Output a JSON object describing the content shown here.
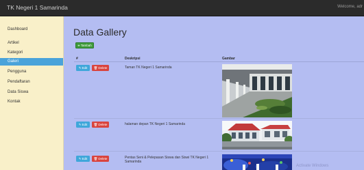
{
  "topbar": {
    "brand": "TK Negeri 1 Samarinda",
    "welcome": "Welcome, adr"
  },
  "sidebar": {
    "items": [
      {
        "label": "Dashboard",
        "active": false
      },
      {
        "label": "Artikel",
        "active": false
      },
      {
        "label": "Kategori",
        "active": false
      },
      {
        "label": "Galeri",
        "active": true
      },
      {
        "label": "Pengguna",
        "active": false
      },
      {
        "label": "Pendaftaran",
        "active": false
      },
      {
        "label": "Data Siswa",
        "active": false
      },
      {
        "label": "Kontak",
        "active": false
      }
    ]
  },
  "page": {
    "title": "Data Gallery",
    "add_label": "Tambah"
  },
  "table": {
    "headers": [
      "#",
      "Deskripsi",
      "Gambar"
    ],
    "edit_label": "Edit",
    "delete_label": "Delete",
    "rows": [
      {
        "desc": "Taman TK Negeri 1 Samarinda",
        "image": "school-garden-corridor-photo"
      },
      {
        "desc": "halaman depan TK Negeri 1 Samarinda",
        "image": "school-front-building-photo"
      },
      {
        "desc": "Pentas Seni & Pelepasan Siswa dan Siswi TK Negeri 1 Samarinda",
        "image": "stage-performance-photo"
      }
    ]
  },
  "watermark": "Activate Windows",
  "colors": {
    "topbar": "#2b2b2b",
    "sidebar": "#f9f0c9",
    "content": "#b4bdf2",
    "active": "#4aa3da",
    "add": "#3f9b3b",
    "edit": "#3fa7da",
    "delete": "#d9443e"
  }
}
